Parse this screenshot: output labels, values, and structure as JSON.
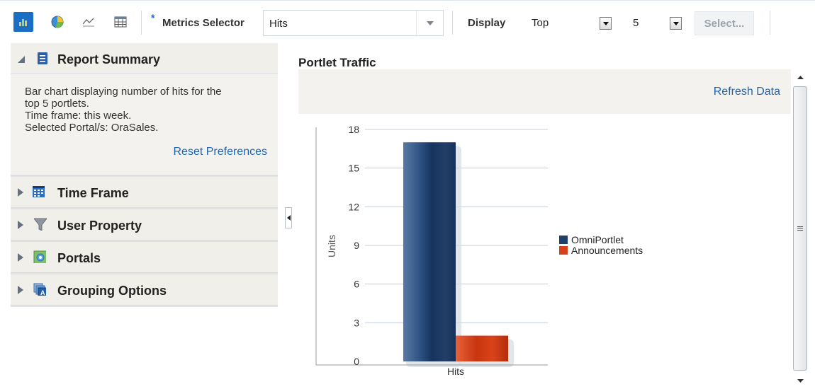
{
  "toolbar": {
    "view_buttons": [
      {
        "icon": "bar-chart-icon",
        "active": true
      },
      {
        "icon": "pie-chart-icon",
        "active": false
      },
      {
        "icon": "line-chart-icon",
        "active": false
      },
      {
        "icon": "table-icon",
        "active": false
      }
    ],
    "required_marker": "*",
    "metrics_label": "Metrics Selector",
    "metrics_value": "Hits",
    "display_label": "Display",
    "display_value": "Top",
    "count_value": "5",
    "select_button": "Select..."
  },
  "left_panel": {
    "report_summary": {
      "title": "Report Summary",
      "lines": [
        "Bar chart displaying number of hits for the",
        "top 5 portlets.",
        "Time frame: this week.",
        "Selected Portal/s: OraSales."
      ],
      "reset_link": "Reset Preferences"
    },
    "sections": [
      {
        "title": "Time Frame",
        "icon": "calendar-icon"
      },
      {
        "title": "User Property",
        "icon": "filter-icon"
      },
      {
        "title": "Portals",
        "icon": "portal-icon"
      },
      {
        "title": "Grouping Options",
        "icon": "grouping-icon"
      }
    ]
  },
  "portlet": {
    "title": "Portlet Traffic",
    "refresh_link": "Refresh Data"
  },
  "colors": {
    "accent": "#1a6fc4",
    "link": "#1d64b4",
    "series_omniportlet": "#1f3f6b",
    "series_announcements": "#d8401a"
  },
  "chart_data": {
    "type": "bar",
    "categories": [
      "Hits"
    ],
    "series": [
      {
        "name": "OmniPortlet",
        "values": [
          17
        ]
      },
      {
        "name": "Announcements",
        "values": [
          2
        ]
      }
    ],
    "ylabel": "Units",
    "xlabel": "",
    "ylim": [
      0,
      18
    ],
    "yticks": [
      0,
      3,
      6,
      9,
      12,
      15,
      18
    ],
    "grid": true,
    "legend_position": "right"
  }
}
